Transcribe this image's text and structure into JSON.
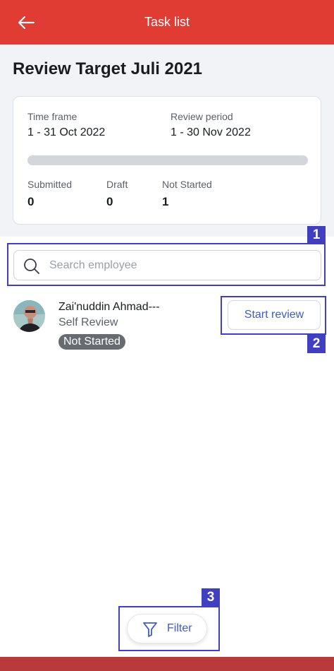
{
  "header": {
    "title": "Task list",
    "back_icon": "arrow-left-icon"
  },
  "review": {
    "title": "Review Target Juli 2021",
    "time_frame_label": "Time frame",
    "time_frame_value": "1 - 31 Oct 2022",
    "review_period_label": "Review period",
    "review_period_value": "1 - 30 Nov 2022",
    "progress_fraction": 0,
    "stats": [
      {
        "label": "Submitted",
        "value": "0"
      },
      {
        "label": "Draft",
        "value": "0"
      },
      {
        "label": "Not Started",
        "value": "1"
      }
    ]
  },
  "search": {
    "placeholder": "Search employee",
    "value": ""
  },
  "employees": [
    {
      "name": "Zai'nuddin Ahmad---",
      "review_type": "Self Review",
      "status": "Not Started",
      "action_label": "Start review"
    }
  ],
  "filter": {
    "label": "Filter",
    "icon": "funnel-icon"
  },
  "annotations": [
    "1",
    "2",
    "3"
  ],
  "colors": {
    "brand_red": "#e03c33",
    "accent_blue": "#3f5cc0",
    "annotation_blue": "#3f3fbf"
  }
}
